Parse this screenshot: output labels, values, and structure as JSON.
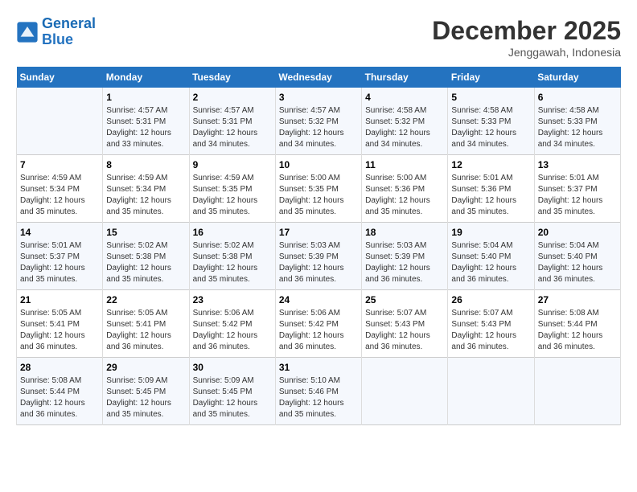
{
  "header": {
    "logo_line1": "General",
    "logo_line2": "Blue",
    "month": "December 2025",
    "location": "Jenggawah, Indonesia"
  },
  "weekdays": [
    "Sunday",
    "Monday",
    "Tuesday",
    "Wednesday",
    "Thursday",
    "Friday",
    "Saturday"
  ],
  "weeks": [
    [
      {
        "day": "",
        "info": ""
      },
      {
        "day": "1",
        "info": "Sunrise: 4:57 AM\nSunset: 5:31 PM\nDaylight: 12 hours\nand 33 minutes."
      },
      {
        "day": "2",
        "info": "Sunrise: 4:57 AM\nSunset: 5:31 PM\nDaylight: 12 hours\nand 34 minutes."
      },
      {
        "day": "3",
        "info": "Sunrise: 4:57 AM\nSunset: 5:32 PM\nDaylight: 12 hours\nand 34 minutes."
      },
      {
        "day": "4",
        "info": "Sunrise: 4:58 AM\nSunset: 5:32 PM\nDaylight: 12 hours\nand 34 minutes."
      },
      {
        "day": "5",
        "info": "Sunrise: 4:58 AM\nSunset: 5:33 PM\nDaylight: 12 hours\nand 34 minutes."
      },
      {
        "day": "6",
        "info": "Sunrise: 4:58 AM\nSunset: 5:33 PM\nDaylight: 12 hours\nand 34 minutes."
      }
    ],
    [
      {
        "day": "7",
        "info": "Sunrise: 4:59 AM\nSunset: 5:34 PM\nDaylight: 12 hours\nand 35 minutes."
      },
      {
        "day": "8",
        "info": "Sunrise: 4:59 AM\nSunset: 5:34 PM\nDaylight: 12 hours\nand 35 minutes."
      },
      {
        "day": "9",
        "info": "Sunrise: 4:59 AM\nSunset: 5:35 PM\nDaylight: 12 hours\nand 35 minutes."
      },
      {
        "day": "10",
        "info": "Sunrise: 5:00 AM\nSunset: 5:35 PM\nDaylight: 12 hours\nand 35 minutes."
      },
      {
        "day": "11",
        "info": "Sunrise: 5:00 AM\nSunset: 5:36 PM\nDaylight: 12 hours\nand 35 minutes."
      },
      {
        "day": "12",
        "info": "Sunrise: 5:01 AM\nSunset: 5:36 PM\nDaylight: 12 hours\nand 35 minutes."
      },
      {
        "day": "13",
        "info": "Sunrise: 5:01 AM\nSunset: 5:37 PM\nDaylight: 12 hours\nand 35 minutes."
      }
    ],
    [
      {
        "day": "14",
        "info": "Sunrise: 5:01 AM\nSunset: 5:37 PM\nDaylight: 12 hours\nand 35 minutes."
      },
      {
        "day": "15",
        "info": "Sunrise: 5:02 AM\nSunset: 5:38 PM\nDaylight: 12 hours\nand 35 minutes."
      },
      {
        "day": "16",
        "info": "Sunrise: 5:02 AM\nSunset: 5:38 PM\nDaylight: 12 hours\nand 35 minutes."
      },
      {
        "day": "17",
        "info": "Sunrise: 5:03 AM\nSunset: 5:39 PM\nDaylight: 12 hours\nand 36 minutes."
      },
      {
        "day": "18",
        "info": "Sunrise: 5:03 AM\nSunset: 5:39 PM\nDaylight: 12 hours\nand 36 minutes."
      },
      {
        "day": "19",
        "info": "Sunrise: 5:04 AM\nSunset: 5:40 PM\nDaylight: 12 hours\nand 36 minutes."
      },
      {
        "day": "20",
        "info": "Sunrise: 5:04 AM\nSunset: 5:40 PM\nDaylight: 12 hours\nand 36 minutes."
      }
    ],
    [
      {
        "day": "21",
        "info": "Sunrise: 5:05 AM\nSunset: 5:41 PM\nDaylight: 12 hours\nand 36 minutes."
      },
      {
        "day": "22",
        "info": "Sunrise: 5:05 AM\nSunset: 5:41 PM\nDaylight: 12 hours\nand 36 minutes."
      },
      {
        "day": "23",
        "info": "Sunrise: 5:06 AM\nSunset: 5:42 PM\nDaylight: 12 hours\nand 36 minutes."
      },
      {
        "day": "24",
        "info": "Sunrise: 5:06 AM\nSunset: 5:42 PM\nDaylight: 12 hours\nand 36 minutes."
      },
      {
        "day": "25",
        "info": "Sunrise: 5:07 AM\nSunset: 5:43 PM\nDaylight: 12 hours\nand 36 minutes."
      },
      {
        "day": "26",
        "info": "Sunrise: 5:07 AM\nSunset: 5:43 PM\nDaylight: 12 hours\nand 36 minutes."
      },
      {
        "day": "27",
        "info": "Sunrise: 5:08 AM\nSunset: 5:44 PM\nDaylight: 12 hours\nand 36 minutes."
      }
    ],
    [
      {
        "day": "28",
        "info": "Sunrise: 5:08 AM\nSunset: 5:44 PM\nDaylight: 12 hours\nand 36 minutes."
      },
      {
        "day": "29",
        "info": "Sunrise: 5:09 AM\nSunset: 5:45 PM\nDaylight: 12 hours\nand 35 minutes."
      },
      {
        "day": "30",
        "info": "Sunrise: 5:09 AM\nSunset: 5:45 PM\nDaylight: 12 hours\nand 35 minutes."
      },
      {
        "day": "31",
        "info": "Sunrise: 5:10 AM\nSunset: 5:46 PM\nDaylight: 12 hours\nand 35 minutes."
      },
      {
        "day": "",
        "info": ""
      },
      {
        "day": "",
        "info": ""
      },
      {
        "day": "",
        "info": ""
      }
    ]
  ]
}
